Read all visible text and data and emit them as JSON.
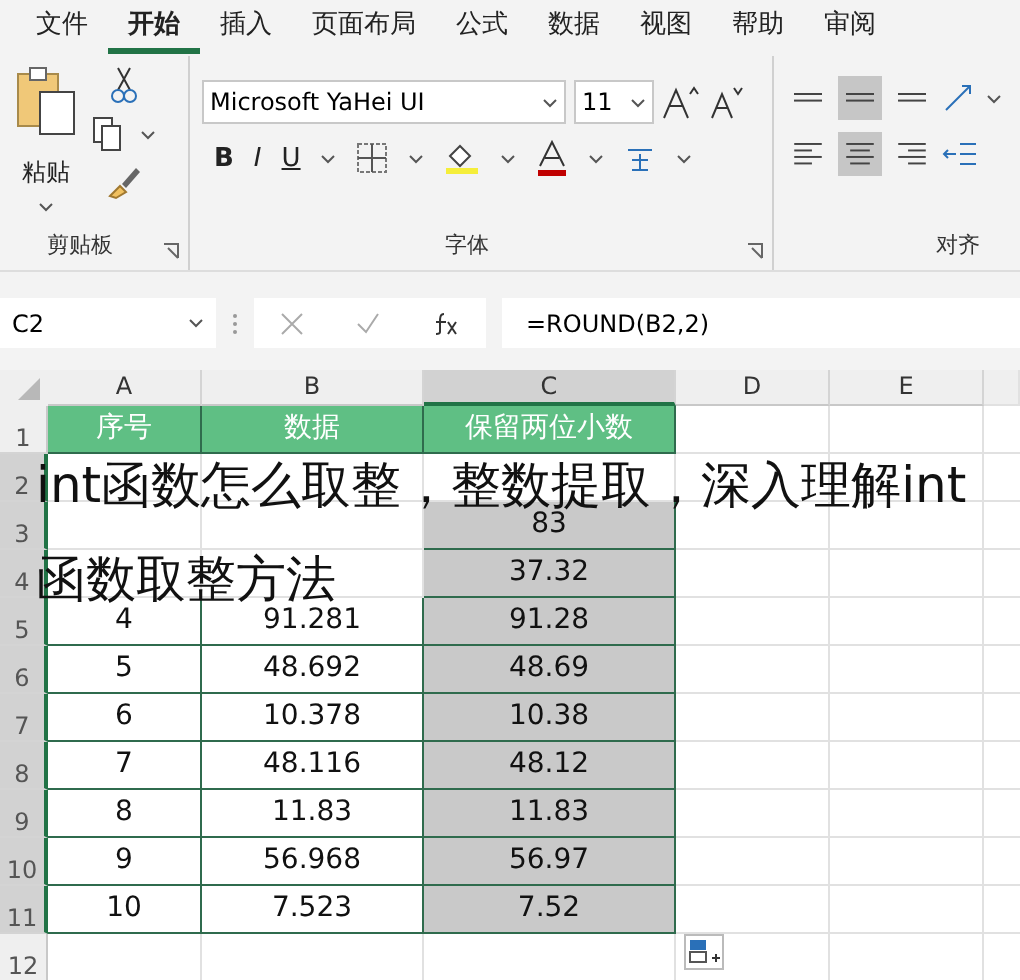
{
  "tabs": [
    {
      "label": "文件",
      "selected": false
    },
    {
      "label": "开始",
      "selected": true
    },
    {
      "label": "插入",
      "selected": false
    },
    {
      "label": "页面布局",
      "selected": false
    },
    {
      "label": "公式",
      "selected": false
    },
    {
      "label": "数据",
      "selected": false
    },
    {
      "label": "视图",
      "selected": false
    },
    {
      "label": "帮助",
      "selected": false
    },
    {
      "label": "审阅",
      "selected": false
    }
  ],
  "ribbon": {
    "clipboard": {
      "paste_label": "粘贴",
      "group_label": "剪贴板"
    },
    "font": {
      "font_name": "Microsoft YaHei UI",
      "font_size": "11",
      "bold_label": "B",
      "italic_label": "I",
      "underline_label": "U",
      "group_label": "字体"
    },
    "alignment": {
      "group_label": "对齐",
      "vertical": [
        {
          "selected": false
        },
        {
          "selected": true
        },
        {
          "selected": false
        }
      ],
      "horizontal": [
        {
          "selected": false
        },
        {
          "selected": true
        },
        {
          "selected": false
        }
      ]
    }
  },
  "formula_bar": {
    "name_box": "C2",
    "formula": "=ROUND(B2,2)"
  },
  "sheet": {
    "columns": [
      {
        "label": "A",
        "selected": false
      },
      {
        "label": "B",
        "selected": false
      },
      {
        "label": "C",
        "selected": true
      },
      {
        "label": "D",
        "selected": false
      },
      {
        "label": "E",
        "selected": false
      }
    ],
    "rows": [
      {
        "number": "1",
        "kind": "header",
        "selected": false,
        "cells": [
          "序号",
          "数据",
          "保留两位小数"
        ]
      },
      {
        "number": "2",
        "kind": "data",
        "selected": true,
        "cells": [
          null,
          null,
          null
        ]
      },
      {
        "number": "3",
        "kind": "data",
        "selected": true,
        "cells": [
          null,
          null,
          "83"
        ]
      },
      {
        "number": "4",
        "kind": "data",
        "selected": true,
        "cells": [
          null,
          null,
          "37.32"
        ]
      },
      {
        "number": "5",
        "kind": "data",
        "selected": true,
        "cells": [
          "4",
          "91.281",
          "91.28"
        ]
      },
      {
        "number": "6",
        "kind": "data",
        "selected": true,
        "cells": [
          "5",
          "48.692",
          "48.69"
        ]
      },
      {
        "number": "7",
        "kind": "data",
        "selected": true,
        "cells": [
          "6",
          "10.378",
          "10.38"
        ]
      },
      {
        "number": "8",
        "kind": "data",
        "selected": true,
        "cells": [
          "7",
          "48.116",
          "48.12"
        ]
      },
      {
        "number": "9",
        "kind": "data",
        "selected": true,
        "cells": [
          "8",
          "11.83",
          "11.83"
        ]
      },
      {
        "number": "10",
        "kind": "data",
        "selected": true,
        "cells": [
          "9",
          "56.968",
          "56.97"
        ]
      },
      {
        "number": "11",
        "kind": "data",
        "selected": true,
        "cells": [
          "10",
          "7.523",
          "7.52"
        ]
      },
      {
        "number": "12",
        "kind": "empty",
        "selected": false,
        "cells": []
      }
    ]
  },
  "overlay_title": [
    "int函数怎么取整，整数提取，深入理解int",
    "函数取整方法"
  ]
}
